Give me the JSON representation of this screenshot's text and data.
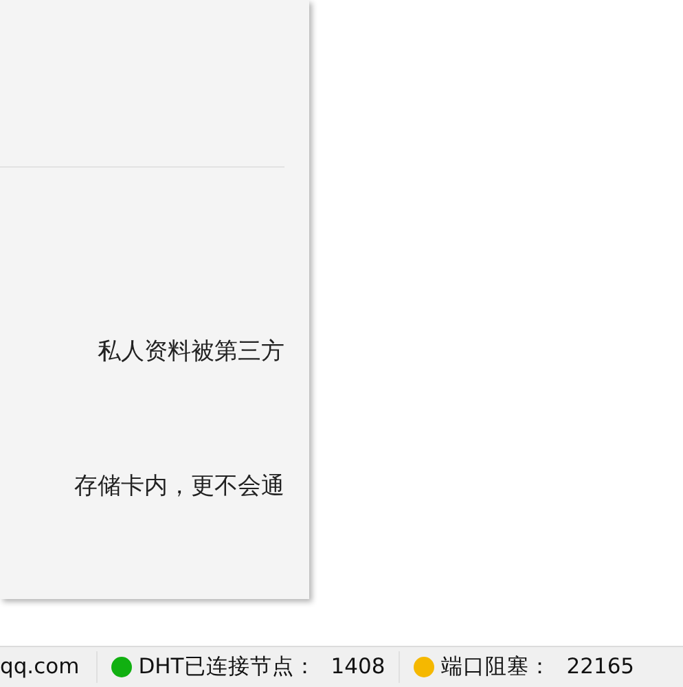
{
  "panel": {
    "paragraphs": [
      "私人资料被第三方",
      "存储卡内，更不会通"
    ]
  },
  "status_bar": [
    {
      "kind": "text",
      "text": "qq.com"
    },
    {
      "kind": "indicator",
      "label": "DHT已连接节点：",
      "value": "1408",
      "color": "#11b011"
    },
    {
      "kind": "indicator",
      "label": "端口阻塞：",
      "value": "22165",
      "color": "#f5b800"
    }
  ]
}
